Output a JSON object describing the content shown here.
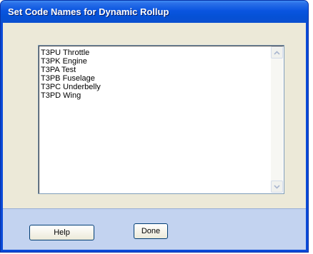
{
  "dialog": {
    "title": "Set Code Names for Dynamic Rollup"
  },
  "list": {
    "items": [
      "T3PU Throttle",
      "T3PK Engine",
      "T3PA Test",
      "T3PB Fuselage",
      "T3PC Underbelly",
      "T3PD Wing"
    ],
    "scrollbar": {
      "up_icon": "chevron-up-icon",
      "down_icon": "chevron-down-icon"
    }
  },
  "footer": {
    "help_label": "Help",
    "done_label": "Done"
  },
  "colors": {
    "titlebar": "#0a55e0",
    "client": "#ece9d8",
    "footer": "#c3d3f0"
  }
}
